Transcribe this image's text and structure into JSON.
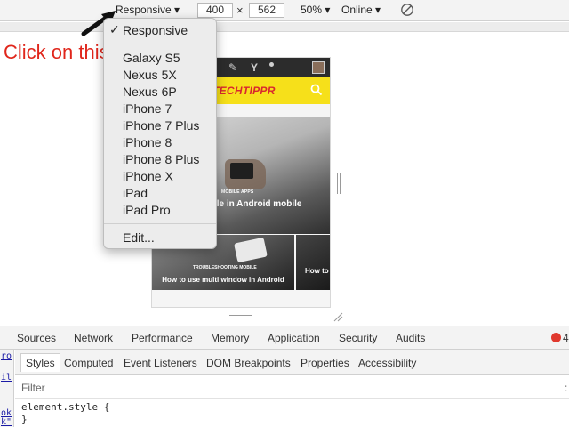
{
  "toolbar": {
    "device_label": "Responsive ▾",
    "width_value": "400",
    "times": "×",
    "height_value": "562",
    "zoom_label": "50% ▾",
    "network_label": "Online ▾",
    "rotate_icon": "rotate-icon"
  },
  "annotation": {
    "text": "Click on this",
    "color": "#e0261b"
  },
  "dropdown": {
    "selected_mark": "✓",
    "items": [
      "Responsive",
      "Galaxy S5",
      "Nexus 5X",
      "Nexus 6P",
      "iPhone 7",
      "iPhone 7 Plus",
      "iPhone 8",
      "iPhone 8 Plus",
      "iPhone X",
      "iPad",
      "iPad Pro",
      "Edit..."
    ]
  },
  "device_page": {
    "logo": "TECHTIPPR",
    "hero_tag": "MOBILE APPS",
    "hero_title": "en zip file in Android mobile",
    "card1_tag": "TROUBLESHOOTING MOBILE",
    "card1_title": "How to use multi window in Android",
    "card2_title": "How to",
    "colors": {
      "topbar": "#2c2c2c",
      "logobar": "#f6e01a",
      "logo_text": "#d9272e"
    }
  },
  "devtools": {
    "tabs": [
      "Sources",
      "Network",
      "Performance",
      "Memory",
      "Application",
      "Security",
      "Audits"
    ],
    "error_count": "4",
    "subtabs": [
      "Styles",
      "Computed",
      "Event Listeners",
      "DOM Breakpoints",
      "Properties",
      "Accessibility"
    ],
    "filter_placeholder": "Filter",
    "filter_clear": ":",
    "code_line1": "element.style {",
    "code_line2": "}",
    "side_links": [
      "ro",
      "il"
    ],
    "side_tail": [
      "ok",
      "k\""
    ]
  }
}
